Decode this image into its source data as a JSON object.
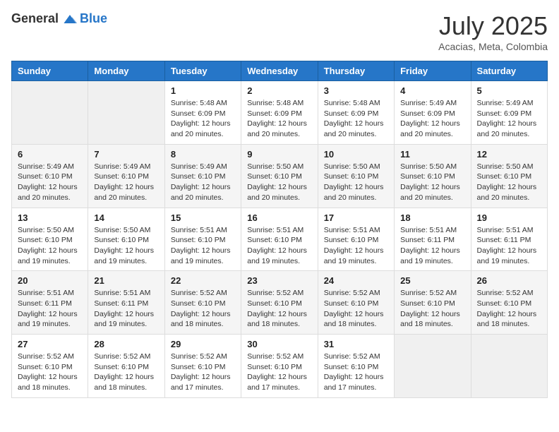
{
  "logo": {
    "general": "General",
    "blue": "Blue"
  },
  "title": "July 2025",
  "location": "Acacias, Meta, Colombia",
  "days_of_week": [
    "Sunday",
    "Monday",
    "Tuesday",
    "Wednesday",
    "Thursday",
    "Friday",
    "Saturday"
  ],
  "weeks": [
    [
      {
        "day": "",
        "info": ""
      },
      {
        "day": "",
        "info": ""
      },
      {
        "day": "1",
        "info": "Sunrise: 5:48 AM\nSunset: 6:09 PM\nDaylight: 12 hours and 20 minutes."
      },
      {
        "day": "2",
        "info": "Sunrise: 5:48 AM\nSunset: 6:09 PM\nDaylight: 12 hours and 20 minutes."
      },
      {
        "day": "3",
        "info": "Sunrise: 5:48 AM\nSunset: 6:09 PM\nDaylight: 12 hours and 20 minutes."
      },
      {
        "day": "4",
        "info": "Sunrise: 5:49 AM\nSunset: 6:09 PM\nDaylight: 12 hours and 20 minutes."
      },
      {
        "day": "5",
        "info": "Sunrise: 5:49 AM\nSunset: 6:09 PM\nDaylight: 12 hours and 20 minutes."
      }
    ],
    [
      {
        "day": "6",
        "info": "Sunrise: 5:49 AM\nSunset: 6:10 PM\nDaylight: 12 hours and 20 minutes."
      },
      {
        "day": "7",
        "info": "Sunrise: 5:49 AM\nSunset: 6:10 PM\nDaylight: 12 hours and 20 minutes."
      },
      {
        "day": "8",
        "info": "Sunrise: 5:49 AM\nSunset: 6:10 PM\nDaylight: 12 hours and 20 minutes."
      },
      {
        "day": "9",
        "info": "Sunrise: 5:50 AM\nSunset: 6:10 PM\nDaylight: 12 hours and 20 minutes."
      },
      {
        "day": "10",
        "info": "Sunrise: 5:50 AM\nSunset: 6:10 PM\nDaylight: 12 hours and 20 minutes."
      },
      {
        "day": "11",
        "info": "Sunrise: 5:50 AM\nSunset: 6:10 PM\nDaylight: 12 hours and 20 minutes."
      },
      {
        "day": "12",
        "info": "Sunrise: 5:50 AM\nSunset: 6:10 PM\nDaylight: 12 hours and 20 minutes."
      }
    ],
    [
      {
        "day": "13",
        "info": "Sunrise: 5:50 AM\nSunset: 6:10 PM\nDaylight: 12 hours and 19 minutes."
      },
      {
        "day": "14",
        "info": "Sunrise: 5:50 AM\nSunset: 6:10 PM\nDaylight: 12 hours and 19 minutes."
      },
      {
        "day": "15",
        "info": "Sunrise: 5:51 AM\nSunset: 6:10 PM\nDaylight: 12 hours and 19 minutes."
      },
      {
        "day": "16",
        "info": "Sunrise: 5:51 AM\nSunset: 6:10 PM\nDaylight: 12 hours and 19 minutes."
      },
      {
        "day": "17",
        "info": "Sunrise: 5:51 AM\nSunset: 6:10 PM\nDaylight: 12 hours and 19 minutes."
      },
      {
        "day": "18",
        "info": "Sunrise: 5:51 AM\nSunset: 6:11 PM\nDaylight: 12 hours and 19 minutes."
      },
      {
        "day": "19",
        "info": "Sunrise: 5:51 AM\nSunset: 6:11 PM\nDaylight: 12 hours and 19 minutes."
      }
    ],
    [
      {
        "day": "20",
        "info": "Sunrise: 5:51 AM\nSunset: 6:11 PM\nDaylight: 12 hours and 19 minutes."
      },
      {
        "day": "21",
        "info": "Sunrise: 5:51 AM\nSunset: 6:11 PM\nDaylight: 12 hours and 19 minutes."
      },
      {
        "day": "22",
        "info": "Sunrise: 5:52 AM\nSunset: 6:10 PM\nDaylight: 12 hours and 18 minutes."
      },
      {
        "day": "23",
        "info": "Sunrise: 5:52 AM\nSunset: 6:10 PM\nDaylight: 12 hours and 18 minutes."
      },
      {
        "day": "24",
        "info": "Sunrise: 5:52 AM\nSunset: 6:10 PM\nDaylight: 12 hours and 18 minutes."
      },
      {
        "day": "25",
        "info": "Sunrise: 5:52 AM\nSunset: 6:10 PM\nDaylight: 12 hours and 18 minutes."
      },
      {
        "day": "26",
        "info": "Sunrise: 5:52 AM\nSunset: 6:10 PM\nDaylight: 12 hours and 18 minutes."
      }
    ],
    [
      {
        "day": "27",
        "info": "Sunrise: 5:52 AM\nSunset: 6:10 PM\nDaylight: 12 hours and 18 minutes."
      },
      {
        "day": "28",
        "info": "Sunrise: 5:52 AM\nSunset: 6:10 PM\nDaylight: 12 hours and 18 minutes."
      },
      {
        "day": "29",
        "info": "Sunrise: 5:52 AM\nSunset: 6:10 PM\nDaylight: 12 hours and 17 minutes."
      },
      {
        "day": "30",
        "info": "Sunrise: 5:52 AM\nSunset: 6:10 PM\nDaylight: 12 hours and 17 minutes."
      },
      {
        "day": "31",
        "info": "Sunrise: 5:52 AM\nSunset: 6:10 PM\nDaylight: 12 hours and 17 minutes."
      },
      {
        "day": "",
        "info": ""
      },
      {
        "day": "",
        "info": ""
      }
    ]
  ]
}
